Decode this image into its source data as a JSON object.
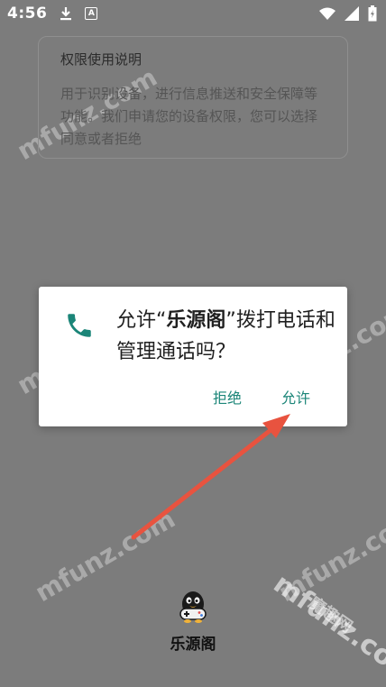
{
  "status_bar": {
    "time": "4:56",
    "icons": [
      "download-icon",
      "notification-a-icon",
      "wifi-icon",
      "signal-icon",
      "battery-icon"
    ],
    "notif_letter": "A"
  },
  "permission_card": {
    "title": "权限使用说明",
    "description": "用于识别设备，进行信息推送和安全保障等功能。我们申请您的设备权限，您可以选择同意或者拒绝"
  },
  "dialog": {
    "icon": "phone-icon",
    "prefix": "允许“",
    "app_name": "乐源阁",
    "suffix": "”拨打电话和管理通话吗？",
    "deny_label": "拒绝",
    "allow_label": "允许"
  },
  "app": {
    "logo": "penguin-gamepad-logo",
    "name": "乐源阁"
  },
  "watermark": {
    "text": "mfunz.com",
    "cn_text": "魔趣网"
  },
  "colors": {
    "scrim": "#7c7c7c",
    "dialog_bg": "#ffffff",
    "accent": "#1b8578",
    "arrow": "#e8533f"
  }
}
